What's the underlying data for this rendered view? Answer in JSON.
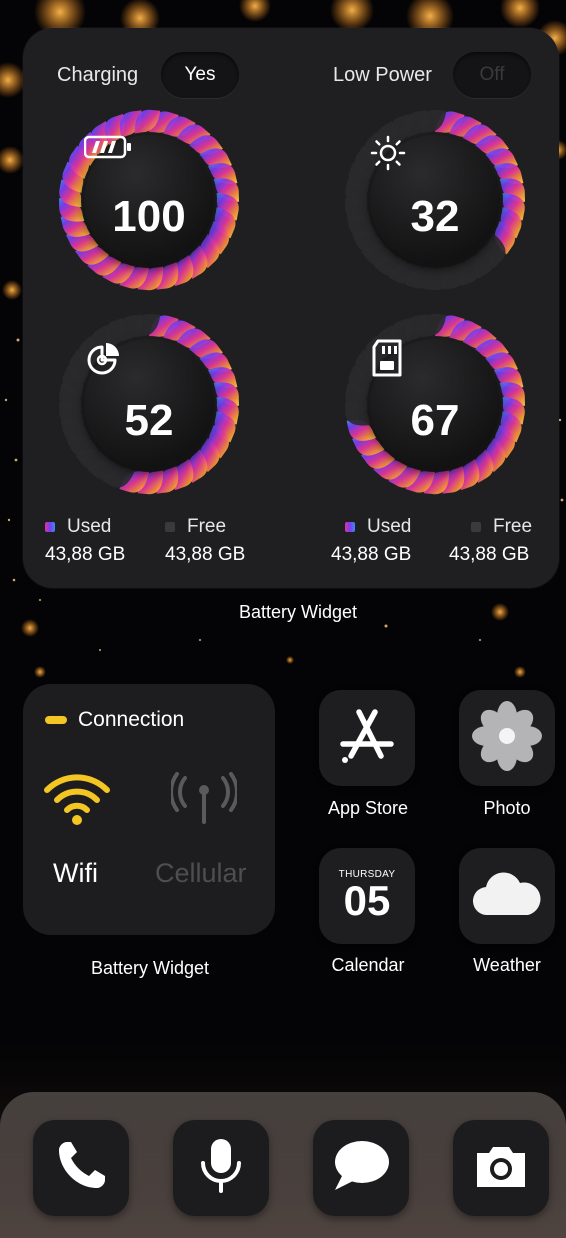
{
  "battery_widget": {
    "charging_label": "Charging",
    "charging_value": "Yes",
    "low_power_label": "Low Power",
    "low_power_value": "Off",
    "gauges": [
      {
        "icon": "battery-icon",
        "value": "100",
        "level": 1.0
      },
      {
        "icon": "brightness-icon",
        "value": "32",
        "level": 0.32
      },
      {
        "icon": "pie-chart-icon",
        "value": "52",
        "level": 0.52
      },
      {
        "icon": "sd-card-icon",
        "value": "67",
        "level": 0.67
      }
    ],
    "storage_left": {
      "used_label": "Used",
      "free_label": "Free",
      "used_value": "43,88 GB",
      "free_value": "43,88 GB"
    },
    "storage_right": {
      "used_label": "Used",
      "free_label": "Free",
      "used_value": "43,88 GB",
      "free_value": "43,88 GB"
    },
    "caption": "Battery Widget"
  },
  "connection_widget": {
    "title": "Connection",
    "wifi_label": "Wifi",
    "cellular_label": "Cellular",
    "caption": "Battery Widget"
  },
  "apps": [
    {
      "name": "App Store",
      "icon": "app-store-icon"
    },
    {
      "name": "Photo",
      "icon": "photo-flower-icon"
    },
    {
      "name": "Calendar",
      "icon": "calendar-icon",
      "weekday": "THURSDAY",
      "day": "05"
    },
    {
      "name": "Weather",
      "icon": "cloud-icon"
    }
  ],
  "dock": [
    {
      "icon": "phone-icon"
    },
    {
      "icon": "microphone-icon"
    },
    {
      "icon": "message-icon"
    },
    {
      "icon": "camera-icon"
    }
  ],
  "colors": {
    "accent_yellow": "#f3c623",
    "ring_gradient": [
      "#3a8df0",
      "#7a3cf0",
      "#e0359a",
      "#f28a3b",
      "#f7d64a"
    ],
    "widget_bg": "#1f1f21"
  }
}
